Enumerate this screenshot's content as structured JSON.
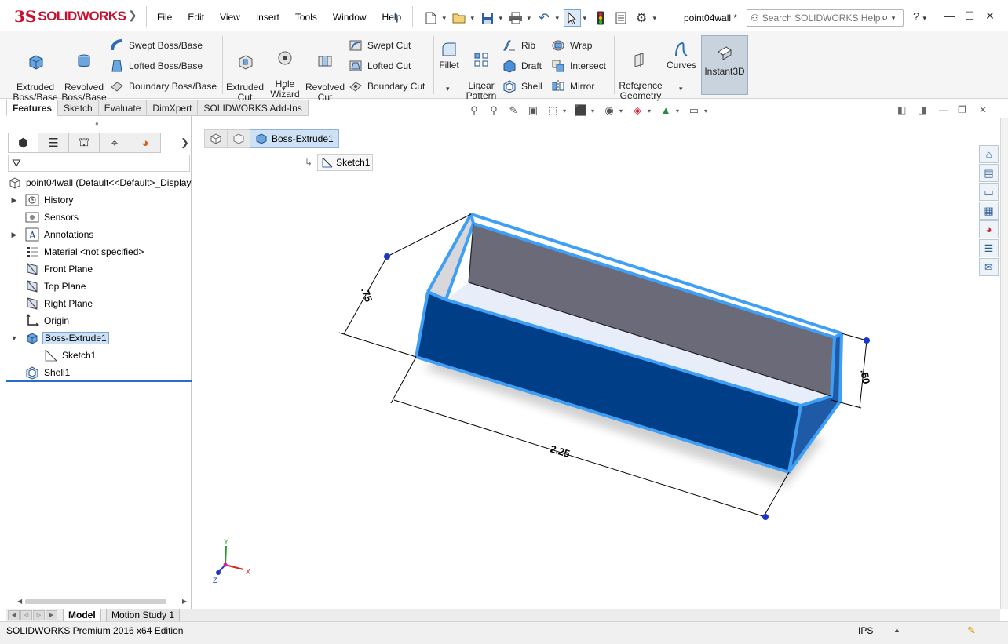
{
  "app": {
    "logo_ds": "3S",
    "logo_text": "SOLIDWORKS",
    "document_title": "point04wall *"
  },
  "menu": [
    "File",
    "Edit",
    "View",
    "Insert",
    "Tools",
    "Window",
    "Help"
  ],
  "search": {
    "placeholder": "Search SOLIDWORKS Help"
  },
  "ribbon": {
    "extruded_boss": "Extruded\nBoss/Base",
    "revolved_boss": "Revolved\nBoss/Base",
    "swept_boss": "Swept Boss/Base",
    "lofted_boss": "Lofted Boss/Base",
    "boundary_boss": "Boundary Boss/Base",
    "extruded_cut": "Extruded\nCut",
    "hole_wizard": "Hole\nWizard",
    "revolved_cut": "Revolved\nCut",
    "swept_cut": "Swept Cut",
    "lofted_cut": "Lofted Cut",
    "boundary_cut": "Boundary Cut",
    "fillet": "Fillet",
    "linear_pattern": "Linear\nPattern",
    "rib": "Rib",
    "draft": "Draft",
    "shell": "Shell",
    "wrap": "Wrap",
    "intersect": "Intersect",
    "mirror": "Mirror",
    "reference_geometry": "Reference\nGeometry",
    "curves": "Curves",
    "instant3d": "Instant3D"
  },
  "cm_tabs": [
    "Features",
    "Sketch",
    "Evaluate",
    "DimXpert",
    "SOLIDWORKS Add-Ins"
  ],
  "tree": {
    "root": "point04wall  (Default<<Default>_Display",
    "items": [
      {
        "label": "History"
      },
      {
        "label": "Sensors"
      },
      {
        "label": "Annotations"
      },
      {
        "label": "Material <not specified>"
      },
      {
        "label": "Front Plane"
      },
      {
        "label": "Top Plane"
      },
      {
        "label": "Right Plane"
      },
      {
        "label": "Origin"
      },
      {
        "label": "Boss-Extrude1"
      },
      {
        "label": "Sketch1"
      },
      {
        "label": "Shell1"
      }
    ]
  },
  "breadcrumb": {
    "feature": "Boss-Extrude1",
    "sketch": "Sketch1"
  },
  "dimensions": {
    "height": ".75",
    "length": "2.25",
    "width": ".50"
  },
  "triad": {
    "x": "X",
    "y": "Y",
    "z": "Z"
  },
  "bottom_tabs": {
    "model": "Model",
    "motion": "Motion Study 1"
  },
  "status": {
    "text": "SOLIDWORKS Premium 2016 x64 Edition",
    "units": "IPS"
  },
  "colors": {
    "brand": "#c8102e",
    "model_face": "#003f87",
    "model_highlight": "#3f9ff5",
    "inner_wall": "#6a6a78"
  }
}
